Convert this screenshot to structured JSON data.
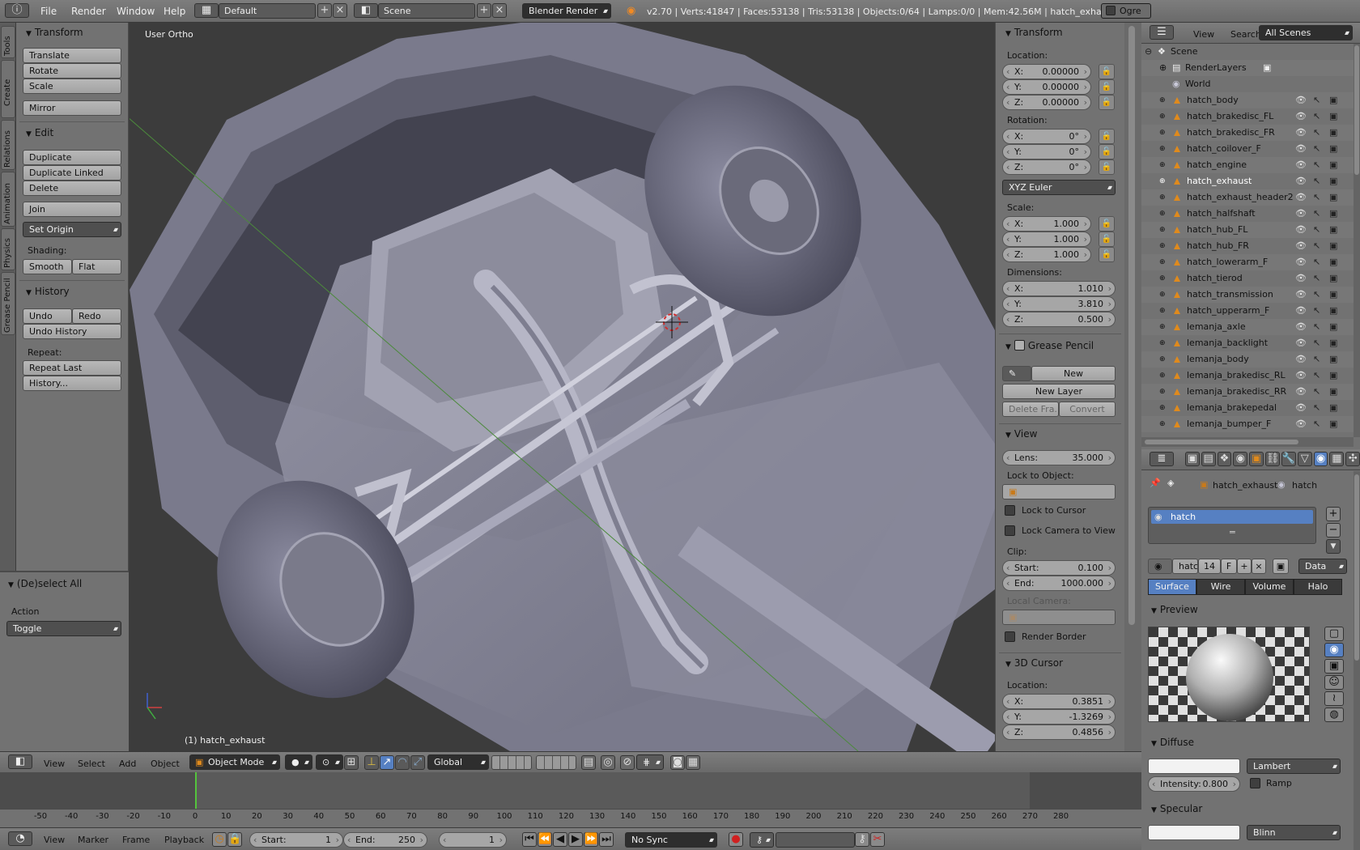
{
  "topbar": {
    "menus": [
      "File",
      "Render",
      "Window",
      "Help"
    ],
    "layout": "Default",
    "scene": "Scene",
    "engine": "Blender Render",
    "stats": "v2.70 | Verts:41847 | Faces:53138 | Tris:53138 | Objects:0/64 | Lamps:0/0 | Mem:42.56M | hatch_exhaust",
    "ogre": "Ogre"
  },
  "left_tabs": [
    "Tools",
    "Create",
    "Relations",
    "Animation",
    "Physics",
    "Grease Pencil"
  ],
  "tools": {
    "transform": {
      "title": "Transform",
      "buttons": [
        "Translate",
        "Rotate",
        "Scale",
        "Mirror"
      ]
    },
    "edit": {
      "title": "Edit",
      "buttons": [
        "Duplicate",
        "Duplicate Linked",
        "Delete",
        "Join"
      ],
      "set_origin": "Set Origin",
      "shading_label": "Shading:",
      "smooth": "Smooth",
      "flat": "Flat"
    },
    "history": {
      "title": "History",
      "undo": "Undo",
      "redo": "Redo",
      "undo_history": "Undo History",
      "repeat_label": "Repeat:",
      "repeat_last": "Repeat Last",
      "history_btn": "History..."
    },
    "operator": {
      "title": "(De)select All",
      "action_label": "Action",
      "action_value": "Toggle"
    }
  },
  "viewport": {
    "view_label": "User Ortho",
    "object_label": "(1) hatch_exhaust"
  },
  "npanel": {
    "transform_title": "Transform",
    "location_label": "Location:",
    "location": [
      {
        "k": "X:",
        "v": "0.00000"
      },
      {
        "k": "Y:",
        "v": "0.00000"
      },
      {
        "k": "Z:",
        "v": "0.00000"
      }
    ],
    "rotation_label": "Rotation:",
    "rotation": [
      {
        "k": "X:",
        "v": "0°"
      },
      {
        "k": "Y:",
        "v": "0°"
      },
      {
        "k": "Z:",
        "v": "0°"
      }
    ],
    "rotation_mode": "XYZ Euler",
    "scale_label": "Scale:",
    "scale": [
      {
        "k": "X:",
        "v": "1.000"
      },
      {
        "k": "Y:",
        "v": "1.000"
      },
      {
        "k": "Z:",
        "v": "1.000"
      }
    ],
    "dimensions_label": "Dimensions:",
    "dimensions": [
      {
        "k": "X:",
        "v": "1.010"
      },
      {
        "k": "Y:",
        "v": "3.810"
      },
      {
        "k": "Z:",
        "v": "0.500"
      }
    ],
    "grease_title": "Grease Pencil",
    "gp_new": "New",
    "gp_new_layer": "New Layer",
    "gp_delete": "Delete Fra...",
    "gp_convert": "Convert",
    "view_title": "View",
    "lens_k": "Lens:",
    "lens_v": "35.000",
    "lock_obj_label": "Lock to Object:",
    "lock_cursor": "Lock to Cursor",
    "lock_camera": "Lock Camera to View",
    "clip_label": "Clip:",
    "clip_start_k": "Start:",
    "clip_start_v": "0.100",
    "clip_end_k": "End:",
    "clip_end_v": "1000.000",
    "local_camera": "Local Camera:",
    "render_border": "Render Border",
    "cursor_title": "3D Cursor",
    "cursor_loc_label": "Location:",
    "cursor": [
      {
        "k": "X:",
        "v": "0.3851"
      },
      {
        "k": "Y:",
        "v": "-1.3269"
      },
      {
        "k": "Z:",
        "v": "0.4856"
      }
    ]
  },
  "outliner": {
    "menus": [
      "View",
      "Search"
    ],
    "filter": "All Scenes",
    "scene": "Scene",
    "renderlayers": "RenderLayers",
    "world": "World",
    "objects": [
      "hatch_body",
      "hatch_brakedisc_FL",
      "hatch_brakedisc_FR",
      "hatch_coilover_F",
      "hatch_engine",
      "hatch_exhaust",
      "hatch_exhaust_header2",
      "hatch_halfshaft",
      "hatch_hub_FL",
      "hatch_hub_FR",
      "hatch_lowerarm_F",
      "hatch_tierod",
      "hatch_transmission",
      "hatch_upperarm_F",
      "lemanja_axle",
      "lemanja_backlight",
      "lemanja_body",
      "lemanja_brakedisc_RL",
      "lemanja_brakedisc_RR",
      "lemanja_brakepedal",
      "lemanja_bumper_F"
    ],
    "active": "hatch_exhaust"
  },
  "props": {
    "breadcrumb_obj": "hatch_exhaust",
    "breadcrumb_mat": "hatch",
    "slot": "hatch",
    "mat_name": "hatc",
    "users": "14",
    "fake": "F",
    "link": "Data",
    "tabs": [
      "Surface",
      "Wire",
      "Volume",
      "Halo"
    ],
    "preview_title": "Preview",
    "diffuse_title": "Diffuse",
    "diffuse_shader": "Lambert",
    "intensity_k": "Intensity:",
    "intensity_v": "0.800",
    "ramp": "Ramp",
    "specular_title": "Specular",
    "specular_shader": "Blinn"
  },
  "view_header": {
    "menus": [
      "View",
      "Select",
      "Add",
      "Object"
    ],
    "mode": "Object Mode",
    "orientation": "Global"
  },
  "timeline": {
    "ticks": [
      -50,
      -40,
      -30,
      -20,
      -10,
      0,
      10,
      20,
      30,
      40,
      50,
      60,
      70,
      80,
      90,
      100,
      110,
      120,
      130,
      140,
      150,
      160,
      170,
      180,
      190,
      200,
      210,
      220,
      230,
      240,
      250,
      260,
      270,
      280
    ],
    "current_frame": 1
  },
  "tl_header": {
    "menus": [
      "View",
      "Marker",
      "Frame",
      "Playback"
    ],
    "start_k": "Start:",
    "start_v": "1",
    "end_k": "End:",
    "end_v": "250",
    "current": "1",
    "sync": "No Sync"
  }
}
